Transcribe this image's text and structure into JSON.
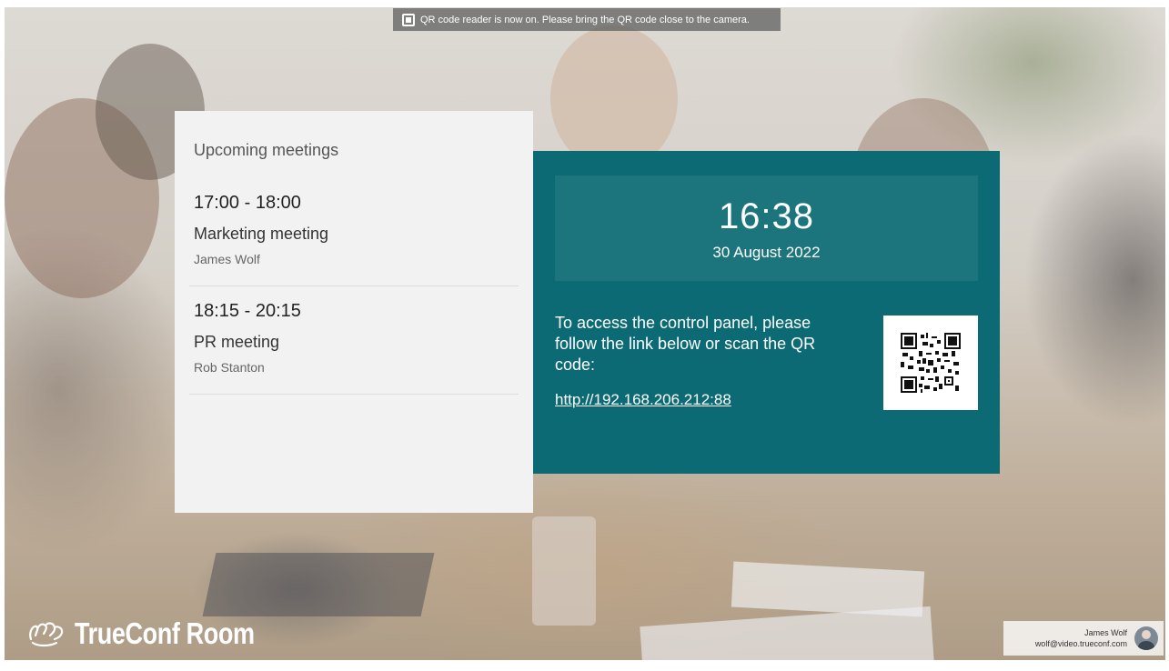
{
  "notice": {
    "text": "QR code reader is now on.  Please bring the QR code close to the camera.",
    "icon": "qr-scan-icon"
  },
  "meetings": {
    "heading": "Upcoming meetings",
    "items": [
      {
        "time": "17:00 - 18:00",
        "title": "Marketing meeting",
        "host": "James Wolf"
      },
      {
        "time": "18:15 - 20:15",
        "title": "PR meeting",
        "host": "Rob Stanton"
      }
    ]
  },
  "clock": {
    "time": "16:38",
    "date": "30 August 2022"
  },
  "access": {
    "text": "To access the control panel, please follow the link below or scan the QR code:",
    "link": "http://192.168.206.212:88",
    "qr_icon": "qr-code-icon"
  },
  "brand": {
    "name": "TrueConf Room",
    "icon": "trueconf-logo-icon"
  },
  "user": {
    "name": "James Wolf",
    "email": "wolf@video.trueconf.com",
    "icon": "avatar"
  },
  "colors": {
    "panel_teal": "#0b6a73",
    "panel_light": "#f2f2f2"
  }
}
